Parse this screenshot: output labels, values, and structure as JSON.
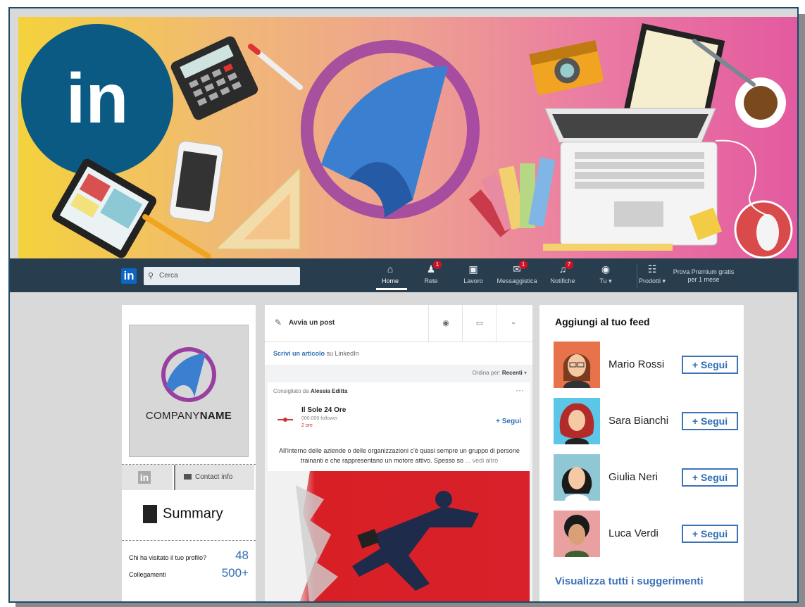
{
  "nav": {
    "logo": "in",
    "search_placeholder": "Cerca",
    "items": [
      {
        "label": "Home",
        "icon": "home-icon",
        "badge": ""
      },
      {
        "label": "Rete",
        "icon": "network-icon",
        "badge": "1"
      },
      {
        "label": "Lavoro",
        "icon": "briefcase-icon",
        "badge": ""
      },
      {
        "label": "Messaggistica",
        "icon": "chat-icon",
        "badge": "1"
      },
      {
        "label": "Notifiche",
        "icon": "bell-icon",
        "badge": "7"
      },
      {
        "label": "Tu ▾",
        "icon": "avatar-icon",
        "badge": ""
      },
      {
        "label": "Prodotti ▾",
        "icon": "grid-icon",
        "badge": ""
      }
    ],
    "premium": "Prova Premium gratis per 1 mese"
  },
  "profile": {
    "company_light": "COMPANY",
    "company_bold": "NAME",
    "li_mini": "in",
    "contact_info": "Contact info",
    "summary": "Summary",
    "visited_label": "Chi ha visitato il tuo profilo?",
    "visited_value": "48",
    "connections_label": "Collegamenti",
    "connections_value": "500+"
  },
  "feed": {
    "start_post": "Avvia un post",
    "article_link": "Scrivi un articolo",
    "article_suffix": "su LinkedIn",
    "order_label": "Ordina per:",
    "order_value": "Recenti",
    "recommended_by": "Consigliato da",
    "recommender": "Alessia Editta",
    "source_name": "Il Sole 24 Ore",
    "source_followers": "000.000 follower",
    "source_time": "2 ore",
    "follow": "+ Segui",
    "body": "All'interno delle aziende o delle organizzazioni c'è quasi sempre un gruppo di persone trainanti e che rappresentano un motore attivo. Spesso so",
    "more": "... vedi altro"
  },
  "suggestions": {
    "title": "Aggiungi al tuo feed",
    "people": [
      {
        "name": "Mario Rossi",
        "button": "+ Segui",
        "bg": "#e8734a"
      },
      {
        "name": "Sara Bianchi",
        "button": "+ Segui",
        "bg": "#5bc6e8"
      },
      {
        "name": "Giulia Neri",
        "button": "+ Segui",
        "bg": "#8fc7d4"
      },
      {
        "name": "Luca Verdi",
        "button": "+ Segui",
        "bg": "#e8a0a0"
      }
    ],
    "see_all": "Visualizza tutti i suggerimenti"
  },
  "colors": {
    "accent": "#3c73b8",
    "nav": "#283e4f",
    "badge": "#d11124"
  }
}
